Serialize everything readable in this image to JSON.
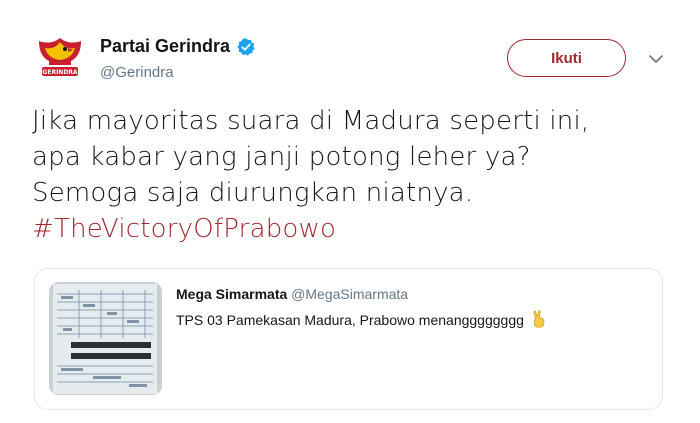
{
  "tweet": {
    "display_name": "Partai Gerindra",
    "handle": "@Gerindra",
    "follow_label": "Ikuti",
    "avatar_text": "GERINDRA",
    "text_lines": [
      "Jika mayoritas suara di Madura seperti ini,",
      "apa kabar yang janji potong leher ya?",
      "Semoga saja diurungkan niatnya."
    ],
    "hashtag": "#TheVictoryOfPrabowo"
  },
  "quote": {
    "display_name": "Mega Simarmata",
    "handle": "@MegaSimarmata",
    "text": "TPS 03 Pamekasan Madura, Prabowo menangggggggg",
    "emoji": "victory-hand-icon"
  },
  "colors": {
    "brand": "#a0292e",
    "text": "#14171a",
    "muted": "#657786",
    "verified": "#1da1f2",
    "border": "#e1e8ed"
  },
  "icons": {
    "verified": "verified-badge-icon",
    "caret": "chevron-down-icon"
  }
}
